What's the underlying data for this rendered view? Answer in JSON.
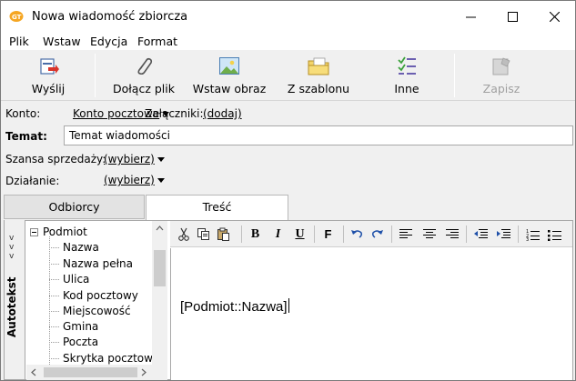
{
  "window": {
    "title": "Nowa wiadomość zbiorcza",
    "controls": {
      "minimize": "minimize",
      "maximize": "maximize",
      "close": "close"
    }
  },
  "menu": [
    "Plik",
    "Wstaw",
    "Edycja",
    "Format"
  ],
  "toolbar": {
    "send": "Wyślij",
    "attach": "Dołącz plik",
    "insert_image": "Wstaw obraz",
    "template": "Z szablonu",
    "other": "Inne",
    "save": "Zapisz"
  },
  "form": {
    "account_label": "Konto:",
    "account_value": "Konto pocztowe",
    "attachments_label": "Załączniki:",
    "attachments_value": "(dodaj)",
    "subject_label": "Temat:",
    "subject_value": "Temat wiadomości",
    "sales_label": "Szansa sprzedaży:",
    "sales_value": "(wybierz)",
    "action_label": "Działanie:",
    "action_value": "(wybierz)"
  },
  "tabs": {
    "recipients": "Odbiorcy",
    "content": "Treść"
  },
  "sidebar": {
    "autotext": "Autotekst",
    "tree_root": "Podmiot",
    "tree_items": [
      "Nazwa",
      "Nazwa pełna",
      "Ulica",
      "Kod pocztowy",
      "Miejscowość",
      "Gmina",
      "Poczta",
      "Skrytka pocztowa"
    ]
  },
  "editor": {
    "content": "[Podmiot::Nazwa]",
    "bold": "B",
    "italic": "I",
    "underline": "U",
    "font": "F"
  },
  "colors": {
    "accent": "#1e5fc4",
    "window_bg": "#f0f0f0"
  }
}
